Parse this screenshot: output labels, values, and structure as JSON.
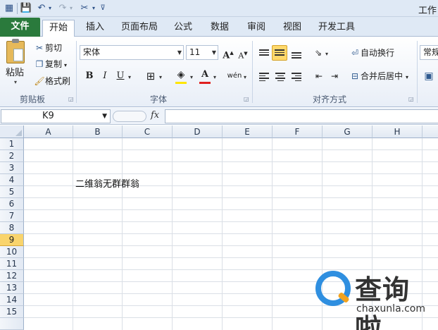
{
  "window": {
    "title": "工作"
  },
  "quick_access": {
    "icons": [
      "save-icon",
      "undo-icon",
      "redo-icon",
      "tools-icon",
      "customize-icon"
    ]
  },
  "ribbon_tabs": [
    "文件",
    "开始",
    "插入",
    "页面布局",
    "公式",
    "数据",
    "审阅",
    "视图",
    "开发工具"
  ],
  "active_tab": "开始",
  "clipboard": {
    "paste": "粘贴",
    "cut": "剪切",
    "copy": "复制",
    "format_painter": "格式刷",
    "group_label": "剪贴板"
  },
  "font": {
    "name": "宋体",
    "size": "11",
    "bold": "B",
    "italic": "I",
    "underline": "U",
    "font_color_letter": "A",
    "phonetic": "wén",
    "group_label": "字体"
  },
  "alignment": {
    "wrap_text": "自动换行",
    "merge_center": "合并后居中",
    "group_label": "对齐方式"
  },
  "number": {
    "format": "常规"
  },
  "formula_bar": {
    "name_box": "K9",
    "fx": "fx",
    "formula": ""
  },
  "sheet": {
    "columns": [
      "A",
      "B",
      "C",
      "D",
      "E",
      "F",
      "G",
      "H"
    ],
    "rows": [
      "1",
      "2",
      "3",
      "4",
      "5",
      "6",
      "7",
      "8",
      "9",
      "10",
      "11",
      "12",
      "13",
      "14",
      "15"
    ],
    "selected_row": "9",
    "cells": {
      "B4": "二维翁无群群翁"
    }
  },
  "watermark": {
    "brand": "查询啦",
    "url": "chaxunla.com"
  },
  "colors": {
    "file_tab": "#2a7a3c",
    "selected_header": "#f9d46c",
    "accent_blue": "#2f8fe0",
    "accent_orange": "#f3a31e"
  }
}
